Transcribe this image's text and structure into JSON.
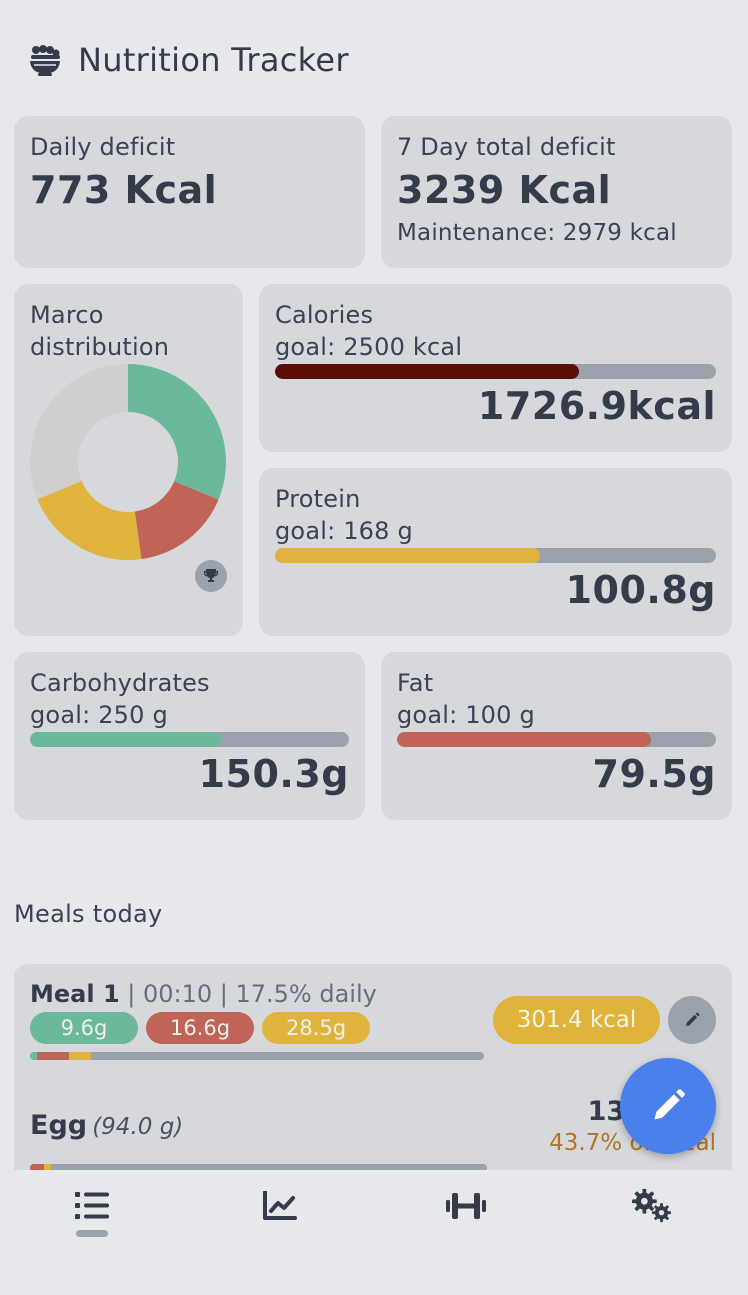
{
  "app": {
    "title": "Nutrition Tracker",
    "icon": "bowl-food-icon"
  },
  "summary": {
    "daily": {
      "label": "Daily deficit",
      "value": "773 Kcal"
    },
    "weekly": {
      "label": "7 Day total deficit",
      "value": "3239 Kcal",
      "maintenance": "Maintenance: 2979 kcal"
    }
  },
  "macro_distribution": {
    "label_line1": "Marco",
    "label_line2": "distribution",
    "trophy_icon": "trophy-icon",
    "chart_data": {
      "type": "pie",
      "slices": [
        {
          "name": "Carbohydrates",
          "value": 150.3,
          "color": "#6bb99a"
        },
        {
          "name": "Fat",
          "value": 79.5,
          "color": "#bf6456"
        },
        {
          "name": "Protein",
          "value": 100.8,
          "color": "#e0b43c"
        },
        {
          "name": "Remaining",
          "value": 150,
          "color": "#cfcfcf"
        }
      ]
    }
  },
  "goals": {
    "calories": {
      "label": "Calories",
      "goal": "goal: 2500 kcal",
      "value": "1726.9kcal",
      "progress": 0.69,
      "color": "#5c0e0b"
    },
    "protein": {
      "label": "Protein",
      "goal": "goal: 168 g",
      "value": "100.8g",
      "progress": 0.6,
      "color": "#e0b43c"
    },
    "carbs": {
      "label": "Carbohydrates",
      "goal": "goal: 250 g",
      "value": "150.3g",
      "progress": 0.6,
      "color": "#6bb99a"
    },
    "fat": {
      "label": "Fat",
      "goal": "goal: 100 g",
      "value": "79.5g",
      "progress": 0.795,
      "color": "#bf6456"
    }
  },
  "meals": {
    "section_title": "Meals today",
    "meal1": {
      "name": "Meal 1",
      "meta": " | 00:10 | 17.5% daily",
      "carbs": "9.6g",
      "fat": "16.6g",
      "protein": "28.5g",
      "kcal": "301.4 kcal",
      "edit_icon": "pencil-icon",
      "macro_bar": {
        "carbs": 0.015,
        "fat": 0.07,
        "protein": 0.05
      }
    },
    "items": [
      {
        "name": "Egg",
        "amount": "(94.0 g)",
        "kcal": "131",
        "share": "43.7% of meal",
        "macro_bar": {
          "fat": 0.03,
          "protein": 0.015
        }
      }
    ]
  },
  "fab": {
    "icon": "pencil-icon"
  },
  "nav": [
    {
      "name": "list-icon",
      "active": true
    },
    {
      "name": "chart-line-icon",
      "active": false
    },
    {
      "name": "dumbbell-icon",
      "active": false
    },
    {
      "name": "gears-icon",
      "active": false
    }
  ],
  "colors": {
    "background": "#e6e8eb",
    "card": "#d6d8dc",
    "fab": "#4a80ec",
    "kcal_pill": "#e0b43c",
    "meal_share": "#b07424"
  }
}
